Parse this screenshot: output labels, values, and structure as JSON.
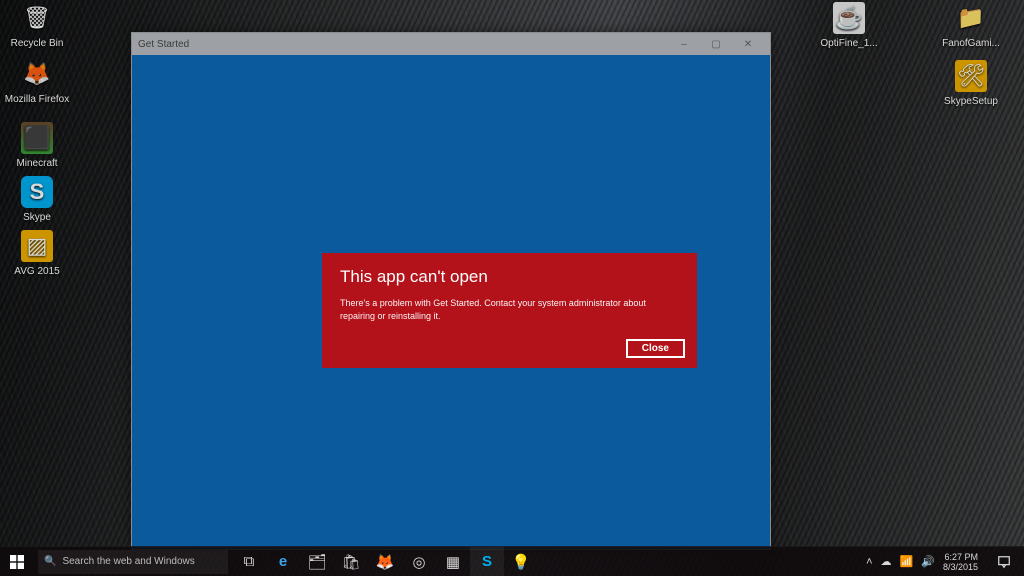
{
  "desktop_icons": {
    "left": [
      {
        "label": "Recycle Bin",
        "glyph": "🗑",
        "bg": ""
      },
      {
        "label": "Mozilla Firefox",
        "glyph": "🦊",
        "bg": ""
      },
      {
        "label": "Minecraft",
        "glyph": "⬛",
        "bg": "linear-gradient(#6b4a2c,#3aa03a)"
      },
      {
        "label": "Skype",
        "glyph": "S",
        "bg": "#00aff0"
      },
      {
        "label": "AVG 2015",
        "glyph": "▨",
        "bg": "#f0b000"
      }
    ],
    "right": [
      {
        "label": "OptiFine_1...",
        "glyph": "☕",
        "bg": "#eaeaea"
      },
      {
        "label": "FanofGami...",
        "glyph": "📁",
        "bg": ""
      },
      {
        "label": "SkypeSetup",
        "glyph": "🛠",
        "bg": "#f0b000"
      }
    ]
  },
  "window": {
    "title": "Get Started",
    "controls": {
      "min": "–",
      "max": "▢",
      "close": "✕"
    }
  },
  "error": {
    "heading": "This app can't open",
    "body": "There's a problem with Get Started. Contact your system administrator about repairing or reinstalling it.",
    "close_label": "Close"
  },
  "taskbar": {
    "search_placeholder": "Search the web and Windows",
    "pinned": [
      {
        "name": "task-view-icon",
        "glyph": "⧉"
      },
      {
        "name": "edge-icon",
        "glyph": "e"
      },
      {
        "name": "explorer-icon",
        "glyph": "🗂"
      },
      {
        "name": "store-icon",
        "glyph": "🛍"
      },
      {
        "name": "firefox-icon",
        "glyph": "🦊"
      },
      {
        "name": "chrome-icon",
        "glyph": "◎"
      },
      {
        "name": "minecraft-icon",
        "glyph": "▦"
      },
      {
        "name": "skype-icon",
        "glyph": "S"
      },
      {
        "name": "tips-icon",
        "glyph": "💡"
      }
    ],
    "tray": {
      "chevron": "˄",
      "onedrive": "☁",
      "net": "📶",
      "vol": "🔊"
    },
    "clock": {
      "time": "6:27 PM",
      "date": "8/3/2015"
    }
  }
}
